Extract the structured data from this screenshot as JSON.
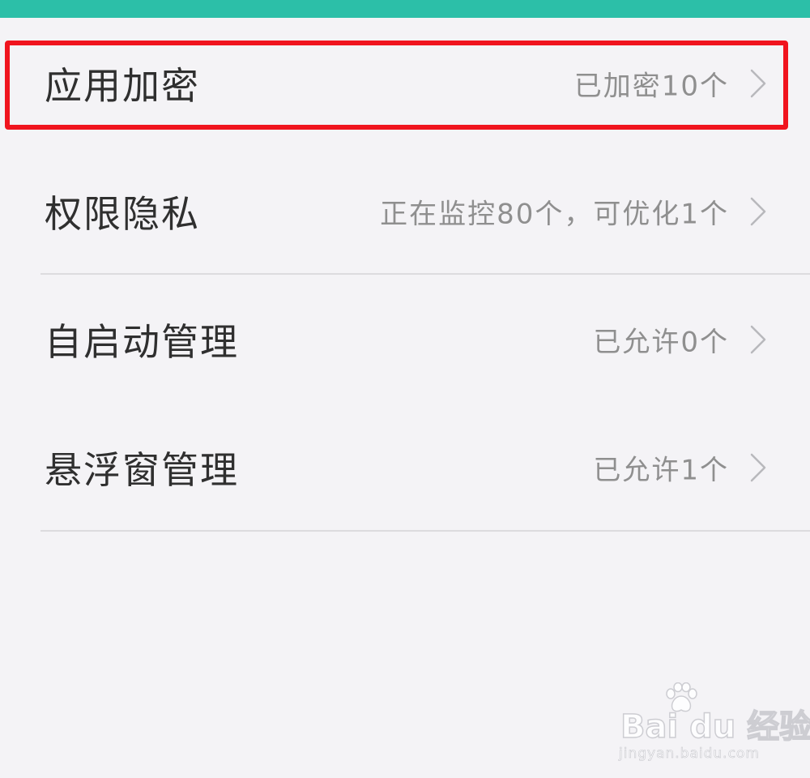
{
  "colors": {
    "status_bar": "#2cbfa8",
    "background": "#f4f3f6",
    "highlight": "#f0141e",
    "title_text": "#2f2f2f",
    "value_text": "#8f8f8f",
    "divider": "#dcdbde",
    "chevron": "#b8b8bc"
  },
  "settings": {
    "items": [
      {
        "title": "应用加密",
        "value": "已加密10个",
        "icon": "chevron-right-icon"
      },
      {
        "title": "权限隐私",
        "value": "正在监控80个，可优化1个",
        "icon": "chevron-right-icon"
      },
      {
        "title": "自启动管理",
        "value": "已允许0个",
        "icon": "chevron-right-icon"
      },
      {
        "title": "悬浮窗管理",
        "value": "已允许1个",
        "icon": "chevron-right-icon"
      }
    ]
  },
  "watermark": {
    "brand": "Bai du 经验",
    "url": "jingyan.baidu.com",
    "icon": "baidu-paw-icon"
  }
}
